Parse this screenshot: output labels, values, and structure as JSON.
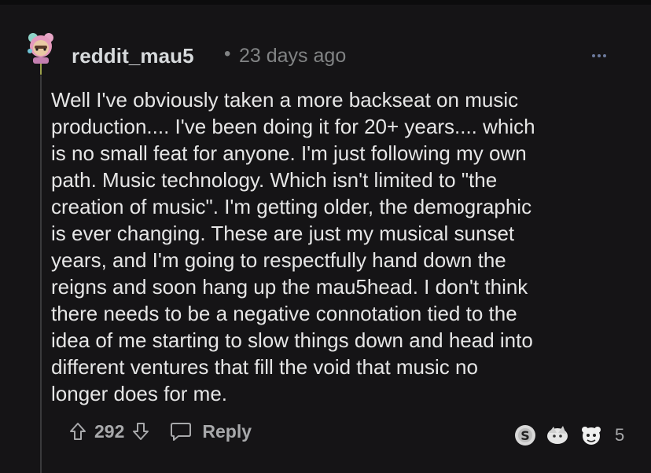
{
  "comment": {
    "username": "reddit_mau5",
    "separator": "•",
    "timestamp": "23 days ago",
    "body": "Well I've obviously taken a more backseat on music\nproduction.... I've been doing it for 20+ years.... which\nis no small feat for anyone. I'm just following my own\npath. Music technology. Which isn't limited to \"the\ncreation of music\". I'm getting older, the demographic\nis ever changing. These are just my musical sunset\nyears, and I'm going to respectfully hand down the\nreigns and soon hang up the mau5head. I don't think\nthere needs to be a negative connotation tied to the\nidea of me starting to slow things down and head into\ndifferent ventures that fill the void that music no\nlonger does for me.",
    "vote_count": "292",
    "reply_label": "Reply",
    "award_count": "5"
  },
  "icons": {
    "avatar": "snoo-avatar-icon",
    "more": "more-options-icon",
    "upvote": "upvote-arrow-icon",
    "downvote": "downvote-arrow-icon",
    "reply": "comment-bubble-icon",
    "awards": [
      "silver-award-icon",
      "wholesome-award-icon",
      "helpful-award-icon"
    ]
  },
  "colors": {
    "background": "#151416",
    "text": "#e6e6e6",
    "muted": "#818384",
    "more_dots": "#6c7a9c"
  }
}
